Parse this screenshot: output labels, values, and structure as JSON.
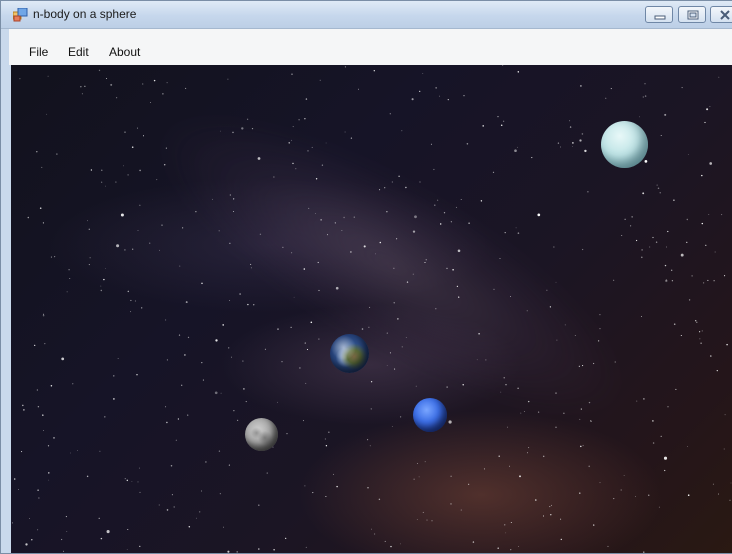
{
  "window": {
    "title": "n-body on a sphere",
    "app_icon": "windows-forms-app-icon",
    "controls": [
      "minimize-icon",
      "maximize-icon",
      "close-icon"
    ]
  },
  "menu": {
    "items": [
      {
        "label": "File"
      },
      {
        "label": "Edit"
      },
      {
        "label": "About"
      }
    ]
  },
  "scene": {
    "background": "starfield-milky-way",
    "bodies": [
      {
        "name": "uranus",
        "color": "#bfe4e6"
      },
      {
        "name": "earth",
        "color": "#3e6aa8"
      },
      {
        "name": "neptune",
        "color": "#3d6fe6"
      },
      {
        "name": "moon",
        "color": "#a4a4a4"
      }
    ]
  }
}
